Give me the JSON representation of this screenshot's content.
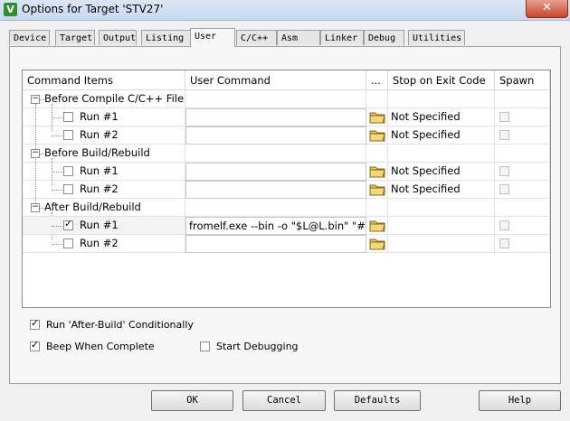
{
  "window": {
    "title": "Options for Target 'STV27'",
    "close_glyph": "✕",
    "app_icon_letter": "V"
  },
  "tabs": [
    "Device",
    "Target",
    "Output",
    "Listing",
    "User",
    "C/C++",
    "Asm",
    "Linker",
    "Debug",
    "Utilities"
  ],
  "active_tab": "User",
  "columns": [
    "Command Items",
    "User Command",
    "...",
    "Stop on Exit Code",
    "Spawn"
  ],
  "groups": [
    {
      "label": "Before Compile C/C++ File",
      "runs": [
        {
          "label": "Run #1",
          "checked": false,
          "command": "",
          "stop": "Not Specified"
        },
        {
          "label": "Run #2",
          "checked": false,
          "command": "",
          "stop": "Not Specified"
        }
      ]
    },
    {
      "label": "Before Build/Rebuild",
      "runs": [
        {
          "label": "Run #1",
          "checked": false,
          "command": "",
          "stop": "Not Specified"
        },
        {
          "label": "Run #2",
          "checked": false,
          "command": "",
          "stop": "Not Specified"
        }
      ]
    },
    {
      "label": "After Build/Rebuild",
      "runs": [
        {
          "label": "Run #1",
          "checked": true,
          "command": "fromelf.exe  --bin -o \"$L@L.bin\" \"#...",
          "stop": ""
        },
        {
          "label": "Run #2",
          "checked": false,
          "command": "",
          "stop": ""
        }
      ]
    }
  ],
  "options": {
    "run_after_build": {
      "label": "Run 'After-Build' Conditionally",
      "checked": true
    },
    "beep": {
      "label": "Beep When Complete",
      "checked": true
    },
    "start_debugging": {
      "label": "Start Debugging",
      "checked": false
    }
  },
  "buttons": {
    "ok": "OK",
    "cancel": "Cancel",
    "defaults": "Defaults",
    "help": "Help"
  },
  "check_glyph": "✓",
  "minus_glyph": "−"
}
